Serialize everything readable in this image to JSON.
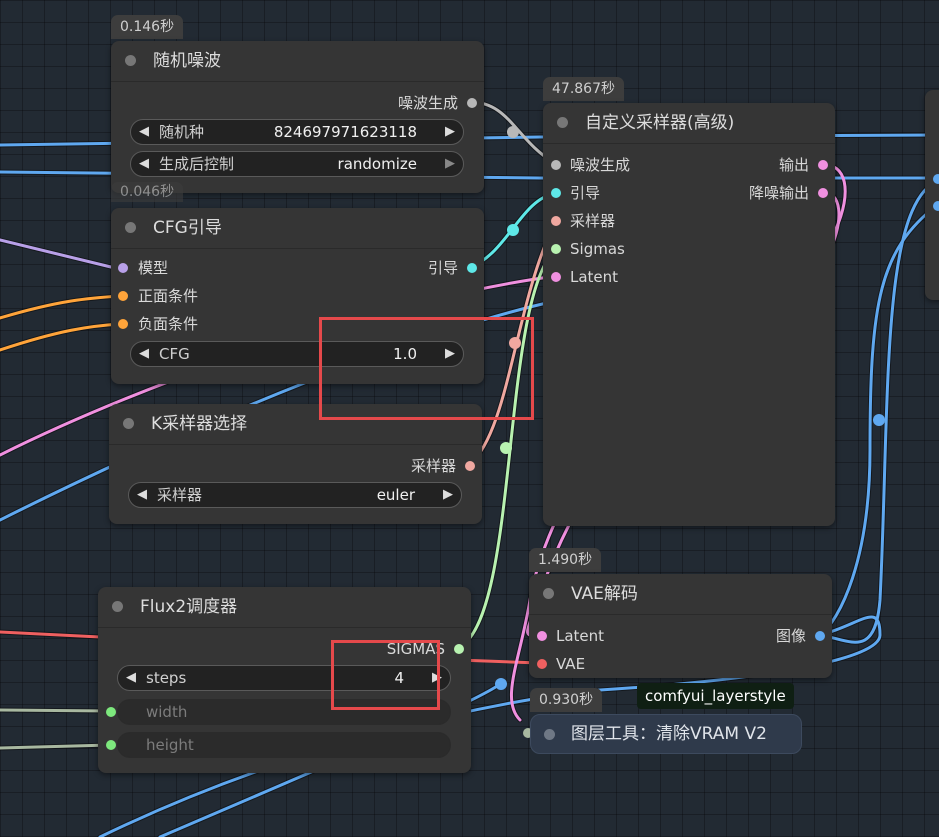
{
  "colors": {
    "background": "#222a33",
    "node": "#353535",
    "wire_blue": "#5fa8f0",
    "wire_pink": "#f090e0",
    "wire_orange": "#ffa43a",
    "wire_green": "#b8f2b0",
    "wire_salmon": "#f0a8a0",
    "wire_red": "#f06060",
    "wire_lavender": "#b8a0e8",
    "wire_grey": "#a8b8a0",
    "wire_white": "#b8b8b8",
    "highlight": "#e5494b"
  },
  "nodes": {
    "random_noise": {
      "time": "0.146秒",
      "title": "随机噪波",
      "output_noise": "噪波生成",
      "seed_label": "随机种",
      "seed_value": "824697971623118",
      "control_label": "生成后控制",
      "control_value": "randomize"
    },
    "cfg_guider": {
      "time": "0.046秒",
      "title": "CFG引导",
      "input_model": "模型",
      "input_positive": "正面条件",
      "input_negative": "负面条件",
      "output_guider": "引导",
      "cfg_label": "CFG",
      "cfg_value": "1.0"
    },
    "k_sampler_select": {
      "title": "K采样器选择",
      "output_sampler": "采样器",
      "sampler_label": "采样器",
      "sampler_value": "euler"
    },
    "custom_sampler": {
      "time": "47.867秒",
      "title": "自定义采样器(高级)",
      "input_noise": "噪波生成",
      "input_guider": "引导",
      "input_sampler": "采样器",
      "input_sigmas": "Sigmas",
      "input_latent": "Latent",
      "output_output": "输出",
      "output_denoised": "降噪输出"
    },
    "flux2_scheduler": {
      "title": "Flux2调度器",
      "output_sigmas": "SIGMAS",
      "steps_label": "steps",
      "steps_value": "4",
      "width_label": "width",
      "height_label": "height"
    },
    "vae_decode": {
      "time": "1.490秒",
      "title": "VAE解码",
      "input_latent": "Latent",
      "input_vae": "VAE",
      "output_image": "图像"
    },
    "clear_vram": {
      "time": "0.930秒",
      "title": "图层工具：清除VRAM V2",
      "tag": "comfyui_layerstyle"
    }
  }
}
